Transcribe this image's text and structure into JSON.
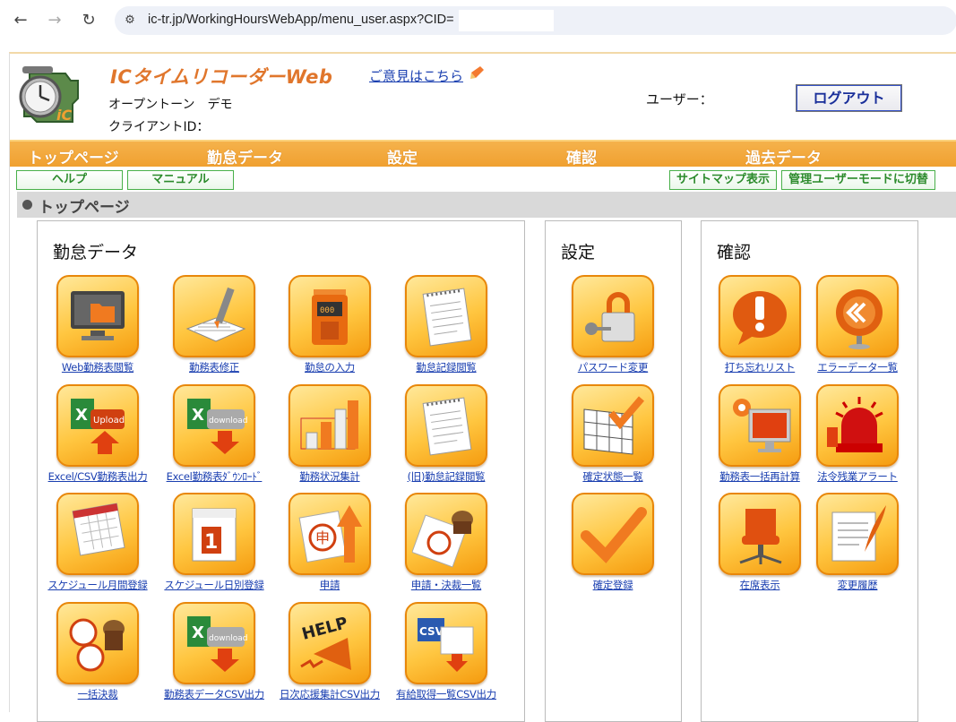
{
  "browser": {
    "url": "ic-tr.jp/WorkingHoursWebApp/menu_user.aspx?CID="
  },
  "header": {
    "title": "ICタイムリコーダーWeb",
    "feedback_link": "ご意見はこちら",
    "company": "オープントーン　デモ",
    "client_id_label": "クライアントID：",
    "user_label": "ユーザー：",
    "logout": "ログアウト"
  },
  "menu": [
    "トップページ",
    "勤怠データ",
    "設定",
    "確認",
    "過去データ"
  ],
  "subnav": {
    "help": "ヘルプ",
    "manual": "マニュアル",
    "sitemap": "サイトマップ表示",
    "admin_mode": "管理ユーザーモードに切替"
  },
  "section": {
    "title": "トップページ"
  },
  "panels": {
    "kintai": {
      "title": "勤怠データ",
      "tiles": [
        {
          "label": "Web勤務表閲覧",
          "icon": "monitor-folder-icon"
        },
        {
          "label": "勤務表修正",
          "icon": "pen-grid-icon"
        },
        {
          "label": "勤怠の入力",
          "icon": "time-clock-icon"
        },
        {
          "label": "勤怠記録閲覧",
          "icon": "notepad-icon"
        },
        {
          "label": "Excel/CSV勤務表出力",
          "icon": "excel-upload-icon"
        },
        {
          "label": "Excel勤務表ﾀﾞｳﾝﾛｰﾄﾞ",
          "icon": "excel-download-icon"
        },
        {
          "label": "勤務状況集計",
          "icon": "bar-chart-3d-icon"
        },
        {
          "label": "(旧)勤怠記録閲覧",
          "icon": "notepad-icon"
        },
        {
          "label": "スケジュール月間登録",
          "icon": "calendar-month-icon"
        },
        {
          "label": "スケジュール日別登録",
          "icon": "calendar-day-icon"
        },
        {
          "label": "申請",
          "icon": "request-arrow-icon"
        },
        {
          "label": "申請・決裁一覧",
          "icon": "stamp-icon"
        },
        {
          "label": "一括決裁",
          "icon": "stamp-multi-icon"
        },
        {
          "label": "勤務表データCSV出力",
          "icon": "excel-download-icon"
        },
        {
          "label": "日次応援集計CSV出力",
          "icon": "help-megaphone-icon"
        },
        {
          "label": "有給取得一覧CSV出力",
          "icon": "csv-export-icon"
        }
      ]
    },
    "settei": {
      "title": "設定",
      "tiles": [
        {
          "label": "パスワード変更",
          "icon": "padlock-key-icon"
        },
        {
          "label": "確定状態一覧",
          "icon": "table-check-icon"
        },
        {
          "label": "確定登録",
          "icon": "checkmark-icon"
        }
      ]
    },
    "kakunin": {
      "title": "確認",
      "tiles": [
        {
          "label": "打ち忘れリスト",
          "icon": "exclamation-bubble-icon"
        },
        {
          "label": "エラーデータ一覧",
          "icon": "error-sign-icon"
        },
        {
          "label": "勤務表一括再計算",
          "icon": "monitor-gear-icon"
        },
        {
          "label": "法令残業アラート",
          "icon": "alarm-light-icon"
        },
        {
          "label": "在席表示",
          "icon": "office-chair-icon"
        },
        {
          "label": "変更履歴",
          "icon": "scroll-quill-icon"
        }
      ]
    }
  }
}
